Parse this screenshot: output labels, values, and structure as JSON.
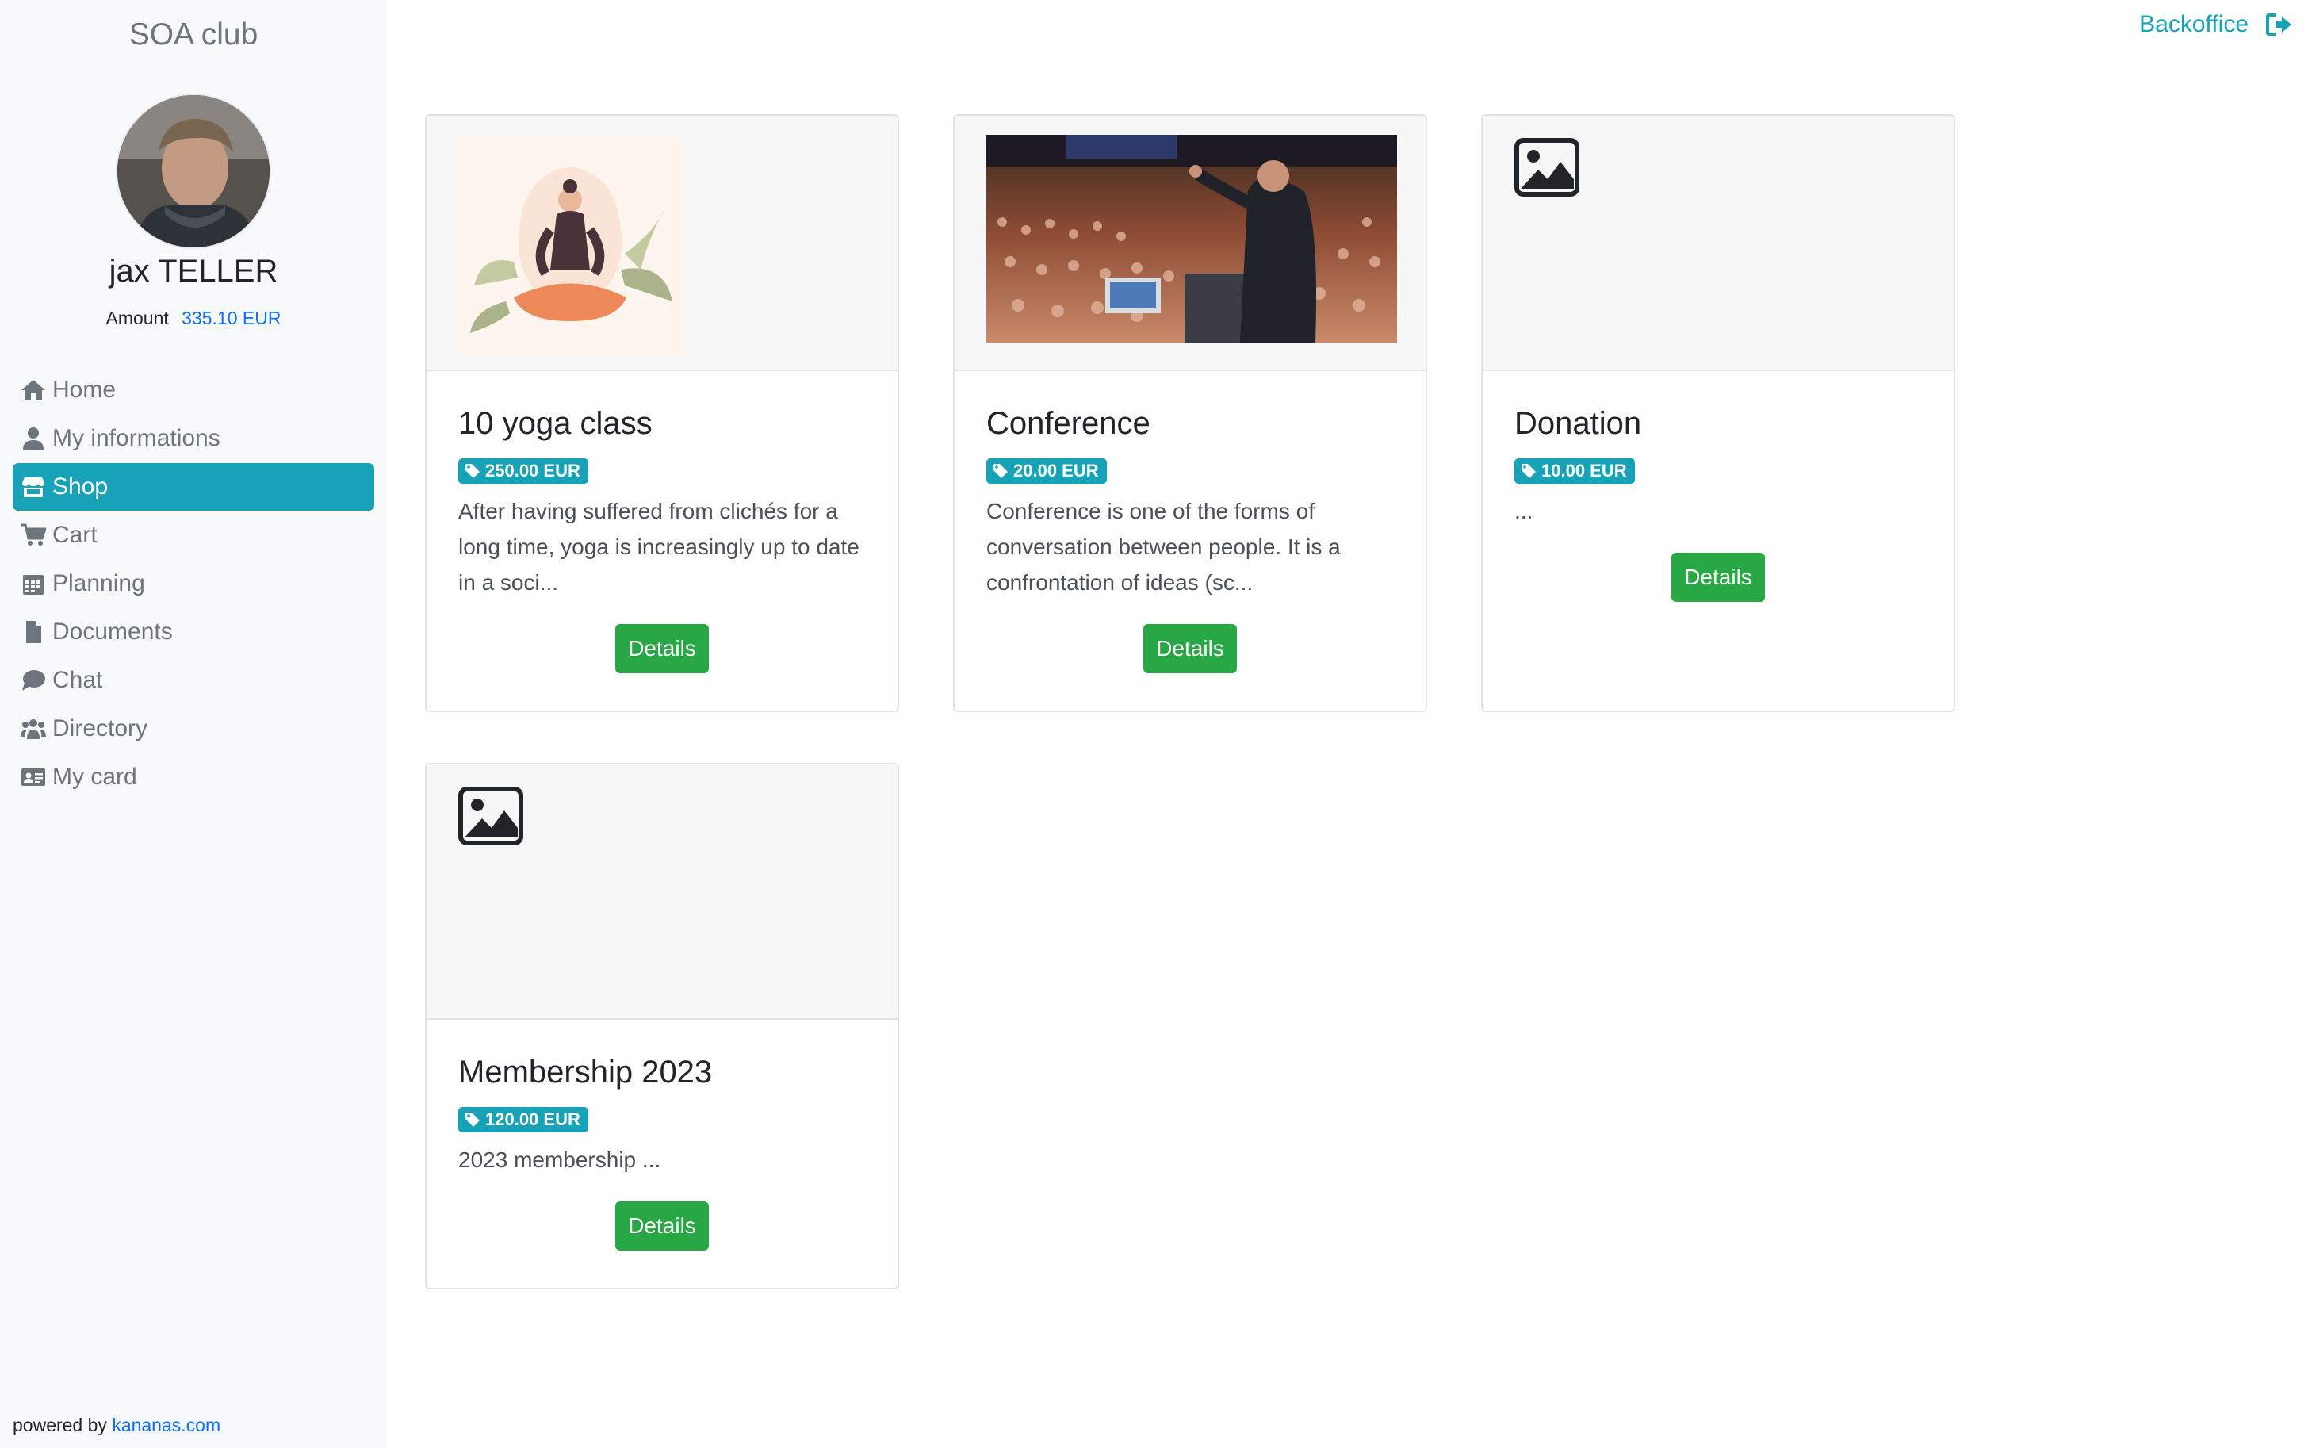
{
  "app": {
    "club_name": "SOA club",
    "backoffice_label": "Backoffice"
  },
  "user": {
    "name": "jax TELLER",
    "amount_label": "Amount",
    "amount_value": "335.10 EUR"
  },
  "nav": {
    "items": [
      {
        "label": "Home",
        "icon": "home-icon"
      },
      {
        "label": "My informations",
        "icon": "user-icon"
      },
      {
        "label": "Shop",
        "icon": "store-icon",
        "active": true
      },
      {
        "label": "Cart",
        "icon": "cart-icon"
      },
      {
        "label": "Planning",
        "icon": "calendar-icon"
      },
      {
        "label": "Documents",
        "icon": "file-icon"
      },
      {
        "label": "Chat",
        "icon": "chat-icon"
      },
      {
        "label": "Directory",
        "icon": "users-icon"
      },
      {
        "label": "My card",
        "icon": "id-card-icon"
      }
    ]
  },
  "footer": {
    "powered_by": "powered by",
    "link": "kananas.com"
  },
  "products": [
    {
      "title": "10 yoga class",
      "price": "250.00 EUR",
      "description": "After having suffered from clichés for a long time, yoga is increasingly up to date in a soci...",
      "button": "Details",
      "image": "yoga-illustration"
    },
    {
      "title": "Conference",
      "price": "20.00 EUR",
      "description": "Conference is one of the forms of conversation between people. It is a confrontation of ideas (sc...",
      "button": "Details",
      "image": "conference-photo"
    },
    {
      "title": "Donation",
      "price": "10.00 EUR",
      "description": "...",
      "button": "Details",
      "image": "image-placeholder-icon"
    },
    {
      "title": "Membership 2023",
      "price": "120.00 EUR",
      "description": "2023 membership ...",
      "button": "Details",
      "image": "image-placeholder-icon"
    }
  ],
  "colors": {
    "accent": "#17a2b8",
    "success": "#28a745",
    "link": "#0d6efd",
    "sidebar_bg": "#f8f9fa"
  }
}
